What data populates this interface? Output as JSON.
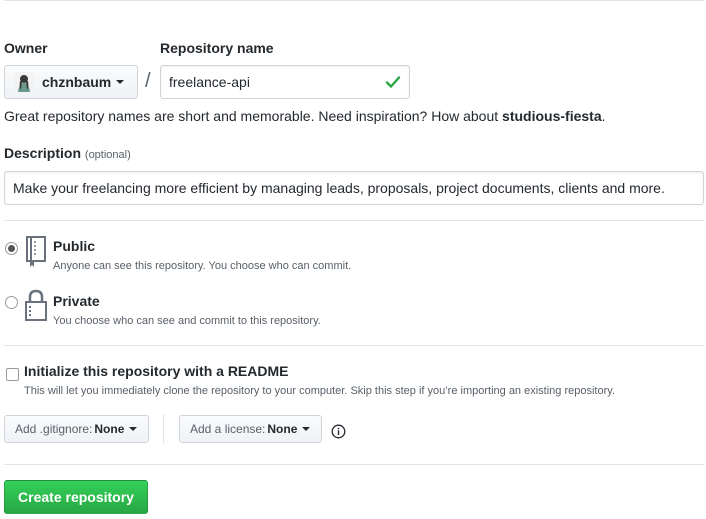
{
  "owner": {
    "label": "Owner",
    "value": "chznbaum"
  },
  "repo": {
    "label": "Repository name",
    "value": "freelance-api"
  },
  "separator": "/",
  "hint": {
    "prefix": "Great repository names are short and memorable. Need inspiration? How about ",
    "suggestion": "studious-fiesta",
    "suffix": "."
  },
  "description": {
    "label": "Description",
    "optional": "(optional)",
    "value": "Make your freelancing more efficient by managing leads, proposals, project documents, clients and more."
  },
  "visibility": {
    "public": {
      "title": "Public",
      "note": "Anyone can see this repository. You choose who can commit.",
      "selected": true
    },
    "private": {
      "title": "Private",
      "note": "You choose who can see and commit to this repository.",
      "selected": false
    }
  },
  "readme": {
    "title": "Initialize this repository with a README",
    "note": "This will let you immediately clone the repository to your computer. Skip this step if you’re importing an existing repository.",
    "checked": false
  },
  "gitignore": {
    "label": "Add .gitignore:",
    "value": "None"
  },
  "license": {
    "label": "Add a license:",
    "value": "None"
  },
  "submit": {
    "label": "Create repository"
  },
  "colors": {
    "accent_green": "#28a745",
    "check_green": "#28a745"
  },
  "icons": {
    "avatar": "avatar",
    "check": "check-icon",
    "repo": "repo-icon",
    "lock": "lock-icon",
    "info": "info-icon"
  }
}
